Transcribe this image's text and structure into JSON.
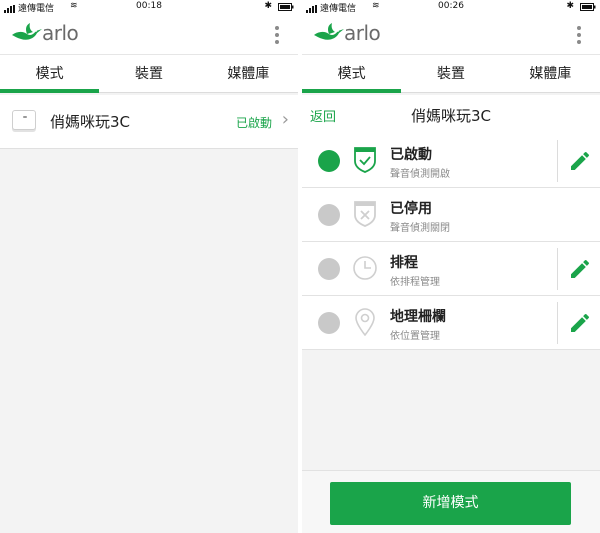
{
  "left": {
    "status": {
      "carrier": "遠傳電信",
      "time": "00:18"
    },
    "app": {
      "logo_text": "arlo"
    },
    "tabs": [
      {
        "label": "模式"
      },
      {
        "label": "裝置"
      },
      {
        "label": "媒體庫"
      }
    ],
    "device": {
      "name": "俏媽咪玩3C",
      "status": "已啟動"
    }
  },
  "right": {
    "status": {
      "carrier": "遠傳電信",
      "time": "00:26"
    },
    "app": {
      "logo_text": "arlo"
    },
    "tabs": [
      {
        "label": "模式"
      },
      {
        "label": "裝置"
      },
      {
        "label": "媒體庫"
      }
    ],
    "subheader": {
      "back_label": "返回",
      "title": "俏媽咪玩3C"
    },
    "modes": [
      {
        "name": "已啟動",
        "desc": "聲音偵測開啟",
        "icon": "shield-check-icon",
        "selected": true,
        "editable": true
      },
      {
        "name": "已停用",
        "desc": "聲音偵測關閉",
        "icon": "shield-x-icon",
        "selected": false,
        "editable": false
      },
      {
        "name": "排程",
        "desc": "依排程管理",
        "icon": "clock-icon",
        "selected": false,
        "editable": true
      },
      {
        "name": "地理柵欄",
        "desc": "依位置管理",
        "icon": "location-pin-icon",
        "selected": false,
        "editable": true
      }
    ],
    "add_mode_label": "新增模式"
  },
  "colors": {
    "accent": "#1aa44a",
    "inactive_radio": "#c9c9c9",
    "background": "#f3f3f3"
  }
}
